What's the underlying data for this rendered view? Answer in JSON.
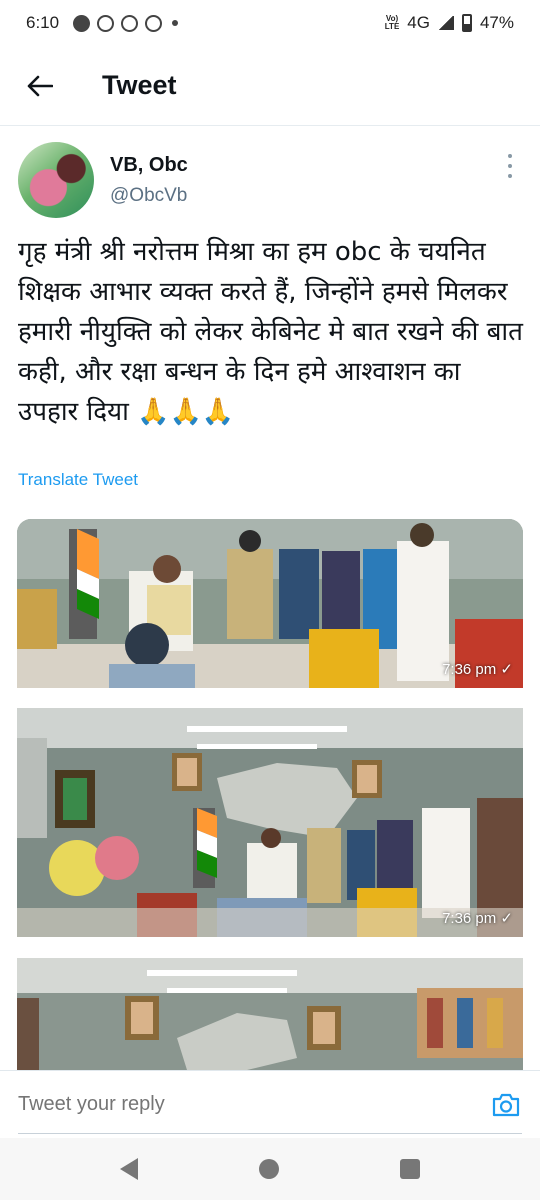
{
  "status_bar": {
    "time": "6:10",
    "network": "4G",
    "volte": "VoLTE",
    "battery": "47%",
    "icons": [
      "chat-bubble-icon",
      "whatsapp-icon",
      "play-icon",
      "play-icon"
    ]
  },
  "header": {
    "title": "Tweet",
    "back_icon": "arrow-left-icon"
  },
  "tweet": {
    "author_name": "VB, Obc",
    "author_handle": "@ObcVb",
    "text": "गृह मंत्री श्री नरोत्तम मिश्रा का हम obc के चयनित शिक्षक आभार व्यक्त करते हैं, जिन्होंने हमसे मिलकर हमारी नीयुक्ति को लेकर केबिनेट मे बात रखने की बात कही, और रक्षा बन्धन के दिन हमे आश्वाशन का उपहार दिया 🙏🙏🙏",
    "translate_label": "Translate Tweet",
    "photos": [
      {
        "timestamp": "7:36 pm ✓"
      },
      {
        "timestamp": "7:36 pm ✓"
      }
    ]
  },
  "reply": {
    "placeholder": "Tweet your reply",
    "camera_icon": "camera-icon"
  },
  "colors": {
    "accent": "#1d9bf0",
    "secondary_text": "#5b7083",
    "primary_text": "#0f1419"
  }
}
